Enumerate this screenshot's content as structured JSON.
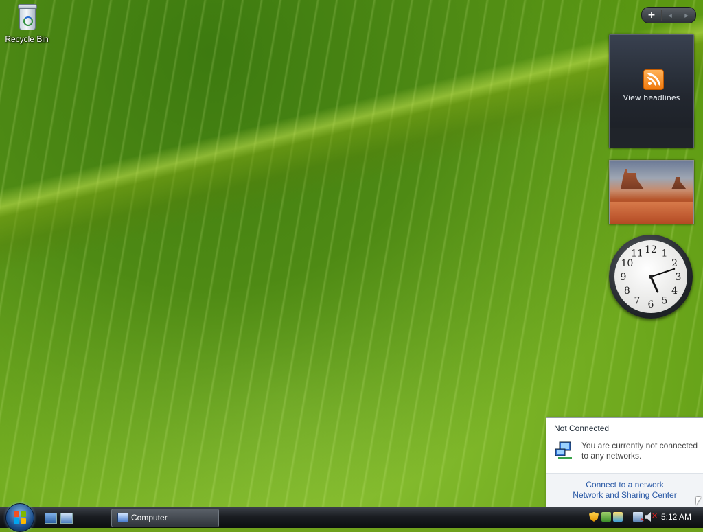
{
  "desktop": {
    "icons": [
      {
        "label": "Recycle Bin",
        "icon": "recycle-bin-icon"
      }
    ]
  },
  "sidebar": {
    "controls": {
      "add": "+",
      "prev": "◂",
      "next": "▸"
    },
    "feed_gadget": {
      "label": "View headlines",
      "icon": "rss-icon"
    },
    "slideshow_gadget": {
      "icon": "landscape-photo"
    },
    "clock_gadget": {
      "hour": 5,
      "minute": 12,
      "numbers": [
        "12",
        "1",
        "2",
        "3",
        "4",
        "5",
        "6",
        "7",
        "8",
        "9",
        "10",
        "11"
      ]
    }
  },
  "notification": {
    "title": "Not Connected",
    "message": "You are currently not connected to any networks.",
    "links": [
      "Connect to a network",
      "Network and Sharing Center"
    ]
  },
  "taskbar": {
    "task_buttons": [
      {
        "label": "Computer"
      }
    ],
    "time": "5:12 AM"
  }
}
